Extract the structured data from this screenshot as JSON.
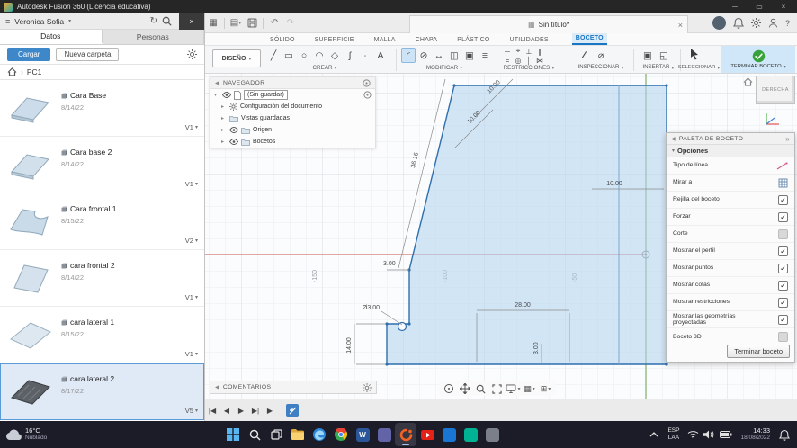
{
  "titlebar": {
    "title": "Autodesk Fusion 360 (Licencia educativa)"
  },
  "quickbar": {
    "document_tab": "Sin título*"
  },
  "data_panel": {
    "user_name": "Veronica Sofia",
    "tab_datos": "Datos",
    "tab_personas": "Personas",
    "upload_button": "Cargar",
    "new_folder_button": "Nueva carpeta",
    "breadcrumb_root": "PC1",
    "items": [
      {
        "name": "Cara Base",
        "date": "8/14/22",
        "version": "V1"
      },
      {
        "name": "Cara base 2",
        "date": "8/14/22",
        "version": "V1"
      },
      {
        "name": "Cara frontal 1",
        "date": "8/15/22",
        "version": "V2"
      },
      {
        "name": "cara frontal 2",
        "date": "8/14/22",
        "version": "V1"
      },
      {
        "name": "cara lateral 1",
        "date": "8/15/22",
        "version": "V1"
      },
      {
        "name": "cara lateral 2",
        "date": "8/17/22",
        "version": "V5"
      }
    ]
  },
  "ribbon": {
    "workspace": "DISEÑO",
    "tabs": [
      "SÓLIDO",
      "SUPERFICIE",
      "MALLA",
      "CHAPA",
      "PLÁSTICO",
      "UTILIDADES",
      "BOCETO"
    ],
    "groups": {
      "crear": "CREAR",
      "modificar": "MODIFICAR",
      "restricciones": "RESTRICCIONES",
      "inspeccionar": "INSPECCIONAR",
      "insertar": "INSERTAR",
      "seleccionar": "SELECCIONAR",
      "terminar": "TERMINAR BOCETO"
    }
  },
  "navegador": {
    "title": "NAVEGADOR",
    "document_name": "(Sin guardar)",
    "items": [
      "Configuración del documento",
      "Vistas guardadas",
      "Origen",
      "Bocetos"
    ]
  },
  "viewcube": {
    "face": "DERECHA"
  },
  "canvas": {
    "dims": {
      "slant": "36.16",
      "top_a": "10.00",
      "top_b": "10.00",
      "right_w": "10.00",
      "step": "3.00",
      "hole": "Ø3.00",
      "width": "28.00",
      "height": "14.00",
      "bottom": "3.00"
    },
    "grid_labels": {
      "x_m150": "-150",
      "x_m100": "-100",
      "x_m50": "-50",
      "y_50": "50"
    }
  },
  "palette": {
    "title": "PALETA DE BOCETO",
    "section_opciones": "Opciones",
    "options": [
      {
        "label": "Tipo de línea",
        "control": "linetype"
      },
      {
        "label": "Mirar a",
        "control": "lookat"
      },
      {
        "label": "Rejilla del boceto",
        "checked": true
      },
      {
        "label": "Forzar",
        "checked": true
      },
      {
        "label": "Corte",
        "checked": false
      },
      {
        "label": "Mostrar el perfil",
        "checked": true
      },
      {
        "label": "Mostrar puntos",
        "checked": true
      },
      {
        "label": "Mostrar cotas",
        "checked": true
      },
      {
        "label": "Mostrar restricciones",
        "checked": true
      },
      {
        "label": "Mostrar las geometrías proyectadas",
        "checked": true
      },
      {
        "label": "Boceto 3D",
        "checked": false
      }
    ],
    "finish_button": "Terminar boceto"
  },
  "comments": {
    "title": "COMENTARIOS"
  },
  "taskbar": {
    "weather_temp": "16°C",
    "weather_cond": "Nublado",
    "lang_line1": "ESP",
    "lang_line2": "LAA",
    "time": "14:33",
    "date": "18/08/2022"
  }
}
